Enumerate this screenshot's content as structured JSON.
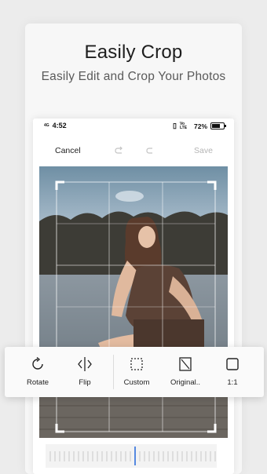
{
  "promo": {
    "title": "Easily Crop",
    "subtitle": "Easily Edit and Crop Your Photos"
  },
  "status_bar": {
    "network": "4G",
    "time": "4:52",
    "network_right": "Vo LTE",
    "battery": "72%",
    "battery_level": 0.72
  },
  "editor": {
    "cancel_label": "Cancel",
    "save_label": "Save",
    "undo_icon": "undo-icon",
    "redo_icon": "redo-icon"
  },
  "tools": [
    {
      "label": "Rotate",
      "icon": "rotate-icon"
    },
    {
      "label": "Flip",
      "icon": "flip-icon"
    },
    {
      "label": "Custom",
      "icon": "custom-crop-icon"
    },
    {
      "label": "Original..",
      "icon": "original-ratio-icon"
    },
    {
      "label": "1:1",
      "icon": "square-ratio-icon"
    }
  ],
  "colors": {
    "accent": "#2f6fdb",
    "save_disabled": "#b5b5b5"
  }
}
